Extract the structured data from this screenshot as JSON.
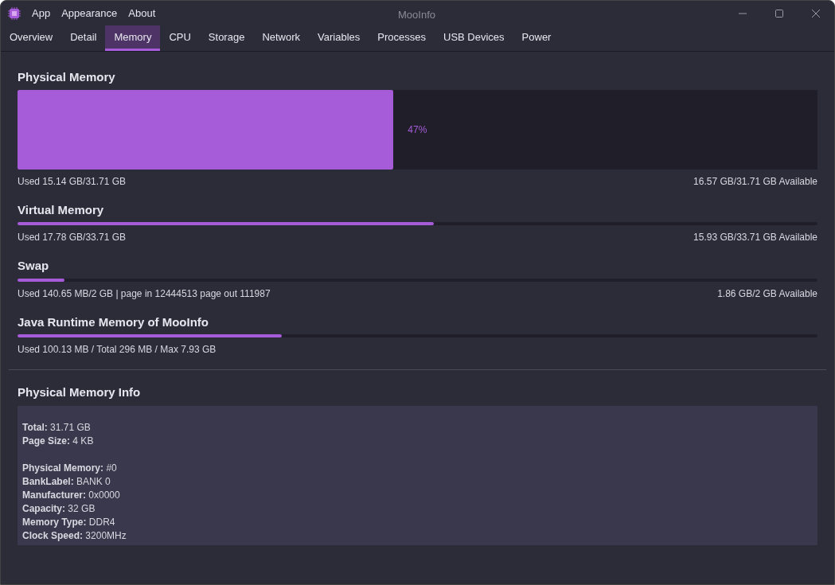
{
  "window": {
    "title": "MooInfo",
    "menu": [
      "App",
      "Appearance",
      "About"
    ]
  },
  "tabs": [
    {
      "label": "Overview",
      "selected": false
    },
    {
      "label": "Detail",
      "selected": false
    },
    {
      "label": "Memory",
      "selected": true
    },
    {
      "label": "CPU",
      "selected": false
    },
    {
      "label": "Storage",
      "selected": false
    },
    {
      "label": "Network",
      "selected": false
    },
    {
      "label": "Variables",
      "selected": false
    },
    {
      "label": "Processes",
      "selected": false
    },
    {
      "label": "USB Devices",
      "selected": false
    },
    {
      "label": "Power",
      "selected": false
    }
  ],
  "meters": [
    {
      "kind": "large",
      "title": "Physical Memory",
      "level": 0.47,
      "percent": "47%",
      "used": "Used 15.14 GB/31.71 GB",
      "available": "16.57 GB/31.71 GB Available"
    },
    {
      "kind": "thin",
      "title": "Virtual Memory",
      "level": 0.52,
      "used": "Used 17.78 GB/33.71 GB",
      "available": "15.93 GB/33.71 GB Available"
    },
    {
      "kind": "thin",
      "title": "Swap",
      "level": 0.059,
      "used": "Used 140.65 MB/2 GB | page in 12444513 page out 111987",
      "available": "1.86 GB/2 GB Available"
    },
    {
      "kind": "thin",
      "title": "Java Runtime Memory of MooInfo",
      "level": 0.33,
      "used": "Used 100.13 MB / Total 296 MB / Max 7.93 GB"
    }
  ],
  "info": {
    "title": "Physical Memory Info",
    "groups": [
      [
        "**Total:** 31.71 GB",
        "**Page Size:** 4 KB"
      ],
      [
        "**Physical Memory:** #0",
        "**BankLabel:** BANK 0",
        "**Manufacturer:** 0x0000",
        "**Capacity:** 32 GB",
        "**Memory Type:** DDR4",
        "**Clock Speed:** 3200MHz"
      ]
    ]
  }
}
